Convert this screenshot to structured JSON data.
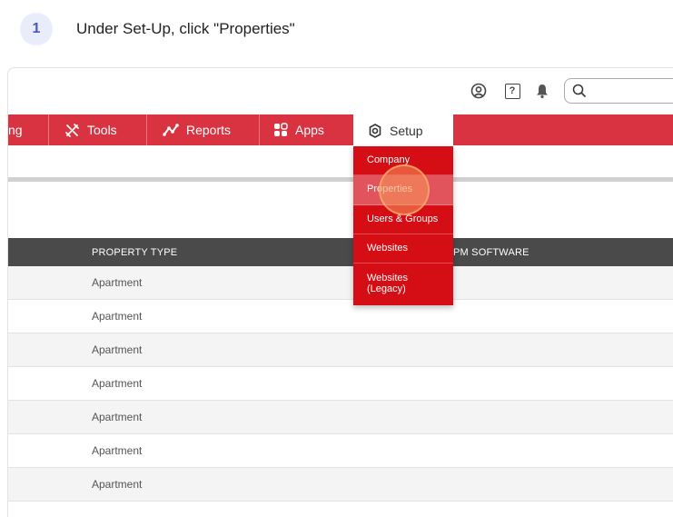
{
  "step": {
    "number": "1",
    "instruction": "Under Set-Up, click \"Properties\""
  },
  "topbar": {
    "icons": [
      "user-circle-icon",
      "help-icon",
      "bell-icon",
      "search-icon"
    ],
    "help_glyph": "?"
  },
  "nav": {
    "truncated_label": "ng",
    "items": [
      {
        "label": "Tools",
        "icon": "tools-icon"
      },
      {
        "label": "Reports",
        "icon": "reports-icon"
      },
      {
        "label": "Apps",
        "icon": "apps-icon"
      },
      {
        "label": "Setup",
        "icon": "gear-icon"
      }
    ]
  },
  "dropdown": {
    "items": [
      {
        "label": "Company"
      },
      {
        "label": "Properties"
      },
      {
        "label": "Users & Groups"
      },
      {
        "label": "Websites"
      },
      {
        "label": "Websites (Legacy)"
      }
    ],
    "highlighted": "Properties"
  },
  "table": {
    "headers": [
      "PROPERTY TYPE",
      "PM SOFTWARE"
    ],
    "rows": [
      {
        "type": "Apartment"
      },
      {
        "type": "Apartment"
      },
      {
        "type": "Apartment"
      },
      {
        "type": "Apartment"
      },
      {
        "type": "Apartment"
      },
      {
        "type": "Apartment"
      },
      {
        "type": "Apartment"
      }
    ]
  },
  "colors": {
    "nav_red": "#d93240",
    "dropdown_red": "#d40e14",
    "step_accent": "#4a55c8",
    "header_dark": "#4a4a4a"
  }
}
